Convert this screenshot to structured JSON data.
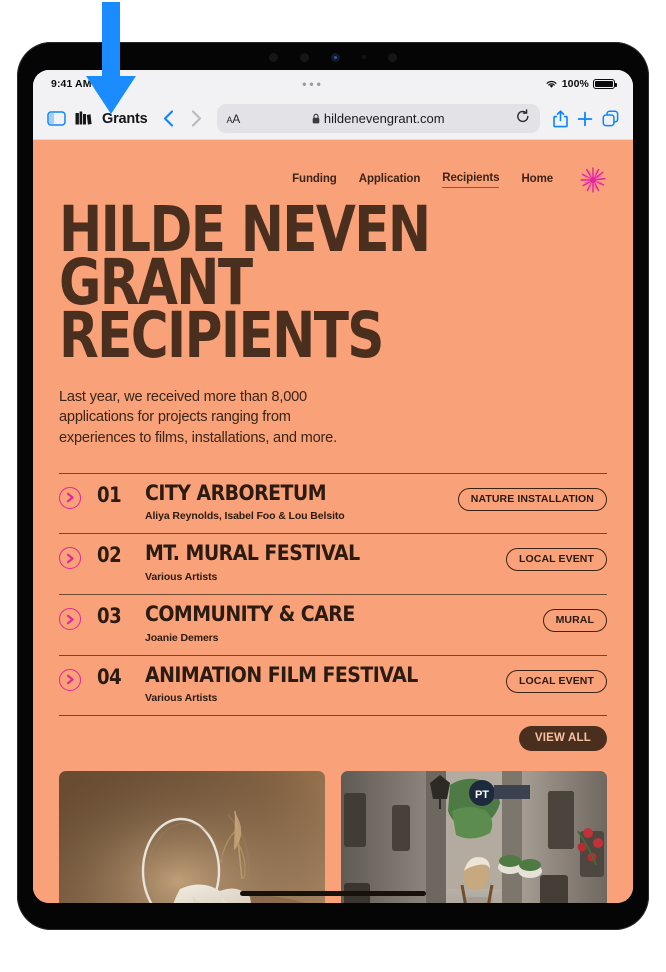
{
  "status_bar": {
    "time": "9:41 AM",
    "center_dots": "•••",
    "battery_percent": "100%",
    "wifi_icon": "wifi-icon",
    "battery_icon": "battery-full-icon"
  },
  "browser": {
    "sidebar_icon": "sidebar-toggle-icon",
    "tab_group_icon": "tab-group-books-icon",
    "tab_group_name": "Grants",
    "back_icon": "chevron-left-icon",
    "forward_icon": "chevron-right-icon",
    "aa_label": "AA",
    "lock_icon": "lock-icon",
    "url": "hildenevengrant.com",
    "reload_icon": "reload-icon",
    "share_icon": "share-icon",
    "new_tab_icon": "plus-icon",
    "tabs_icon": "tabs-overview-icon"
  },
  "site": {
    "nav": [
      {
        "label": "Funding",
        "active": false
      },
      {
        "label": "Application",
        "active": false
      },
      {
        "label": "Recipients",
        "active": true
      },
      {
        "label": "Home",
        "active": false
      }
    ],
    "logo_icon": "starburst-flower-logo",
    "hero_title": "HILDE NEVEN\nGRANT RECIPIENTS",
    "hero_subtitle": "Last year, we received more than 8,000\napplications for projects ranging from\nexperiences to films, installations, and more.",
    "recipients": [
      {
        "arrow_icon": "arrow-right-circle-icon",
        "number": "01",
        "title": "CITY ARBORETUM",
        "artists": "Aliya Reynolds, Isabel Foo & Lou Belsito",
        "tag": "NATURE INSTALLATION"
      },
      {
        "arrow_icon": "arrow-right-circle-icon",
        "number": "02",
        "title": "MT. MURAL FESTIVAL",
        "artists": "Various Artists",
        "tag": "LOCAL EVENT"
      },
      {
        "arrow_icon": "arrow-right-circle-icon",
        "number": "03",
        "title": "COMMUNITY & CARE",
        "artists": "Joanie Demers",
        "tag": "MURAL"
      },
      {
        "arrow_icon": "arrow-right-circle-icon",
        "number": "04",
        "title": "ANIMATION FILM FESTIVAL",
        "artists": "Various Artists",
        "tag": "LOCAL EVENT"
      }
    ],
    "view_all_label": "VIEW ALL",
    "gallery": [
      {
        "name": "still-life-ring-chalk-brick-photo"
      },
      {
        "name": "person-backpack-stone-alley-photo"
      }
    ]
  },
  "annotation": {
    "arrow_icon": "blue-down-arrow-annotation",
    "color": "#1a8cff"
  },
  "colors": {
    "page_background": "#f9a178",
    "ink": "#2b1b12",
    "heading": "#4a2f1f",
    "accent_pink": "#e0279c",
    "browser_chrome": "#f2f2f4",
    "ios_blue": "#0a84ff"
  }
}
